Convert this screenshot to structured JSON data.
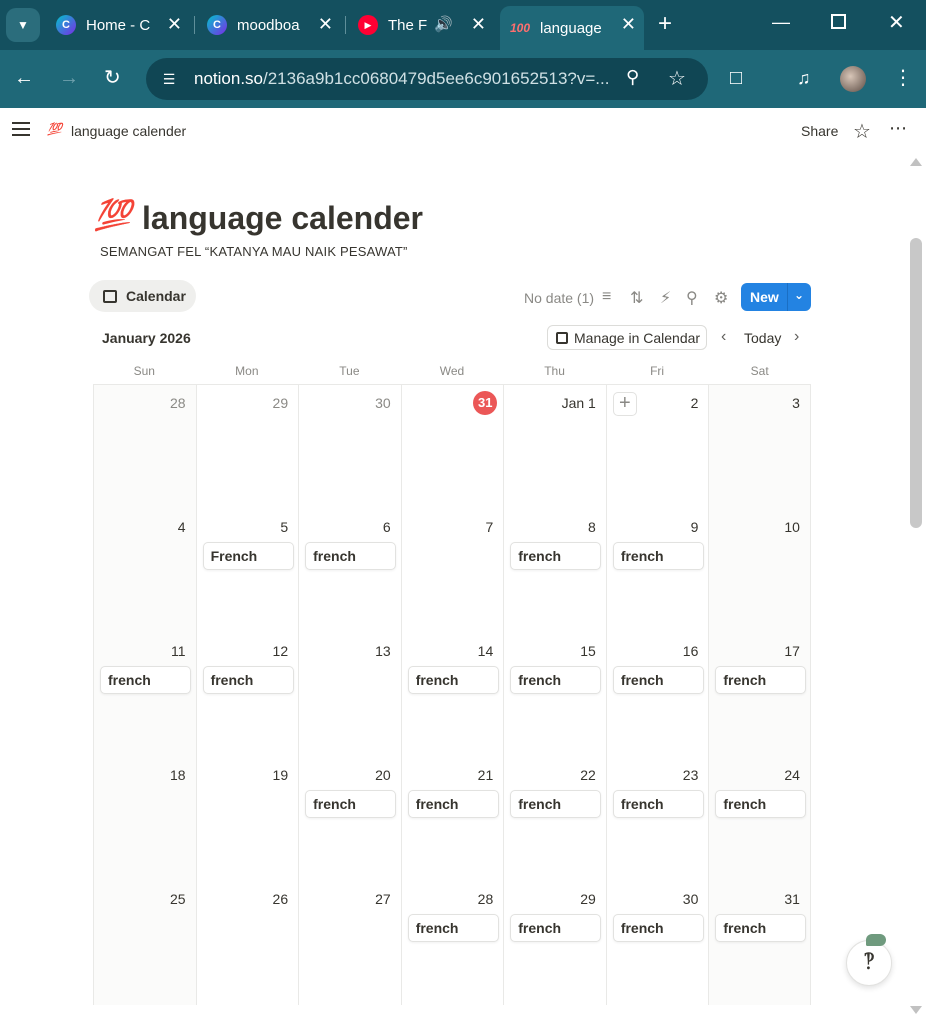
{
  "browser": {
    "tabs": [
      {
        "title": "Home - C",
        "favicon": "canva-icon",
        "active": false
      },
      {
        "title": "moodboa",
        "favicon": "canva-icon",
        "active": false
      },
      {
        "title": "The F",
        "favicon": "youtube-music-icon",
        "active": false,
        "audio": true
      },
      {
        "title": "language",
        "favicon": "hundred-points-icon",
        "active": true
      }
    ],
    "url_host": "notion.so",
    "url_path": "/2136a9b1cc0680479d5ee6c901652513?v=...",
    "colors": {
      "tabbar": "#14505f",
      "toolbar": "#1f6878"
    }
  },
  "topbar": {
    "breadcrumb_emoji": "💯",
    "breadcrumb": "language calender",
    "share_label": "Share"
  },
  "page": {
    "emoji": "💯",
    "title": "language calender",
    "subtitle": "SEMANGAT FEL  “KATANYA MAU NAIK PESAWAT”"
  },
  "view": {
    "tab_label": "Calendar",
    "no_date_label": "No date (1)",
    "new_label": "New",
    "accent": "#2383e2"
  },
  "calendar": {
    "month_label": "January 2026",
    "manage_label": "Manage in Calendar",
    "today_label": "Today",
    "weekdays": [
      "Sun",
      "Mon",
      "Tue",
      "Wed",
      "Thu",
      "Fri",
      "Sat"
    ],
    "weeks": [
      [
        {
          "label": "28",
          "outside": true
        },
        {
          "label": "29",
          "outside": true
        },
        {
          "label": "30",
          "outside": true
        },
        {
          "label": "31",
          "today": true
        },
        {
          "label": "Jan 1"
        },
        {
          "label": "2",
          "add_button": true
        },
        {
          "label": "3"
        }
      ],
      [
        {
          "label": "4"
        },
        {
          "label": "5",
          "event": "French"
        },
        {
          "label": "6",
          "event": "french"
        },
        {
          "label": "7"
        },
        {
          "label": "8",
          "event": "french"
        },
        {
          "label": "9",
          "event": "french"
        },
        {
          "label": "10"
        }
      ],
      [
        {
          "label": "11",
          "event": "french"
        },
        {
          "label": "12",
          "event": "french"
        },
        {
          "label": "13"
        },
        {
          "label": "14",
          "event": "french"
        },
        {
          "label": "15",
          "event": "french"
        },
        {
          "label": "16",
          "event": "french"
        },
        {
          "label": "17",
          "event": "french"
        }
      ],
      [
        {
          "label": "18"
        },
        {
          "label": "19"
        },
        {
          "label": "20",
          "event": "french"
        },
        {
          "label": "21",
          "event": "french"
        },
        {
          "label": "22",
          "event": "french"
        },
        {
          "label": "23",
          "event": "french"
        },
        {
          "label": "24",
          "event": "french"
        }
      ],
      [
        {
          "label": "25"
        },
        {
          "label": "26"
        },
        {
          "label": "27"
        },
        {
          "label": "28",
          "event": "french"
        },
        {
          "label": "29",
          "event": "french"
        },
        {
          "label": "30",
          "event": "french"
        },
        {
          "label": "31",
          "event": "french"
        }
      ]
    ],
    "today_color": "#eb5757"
  }
}
